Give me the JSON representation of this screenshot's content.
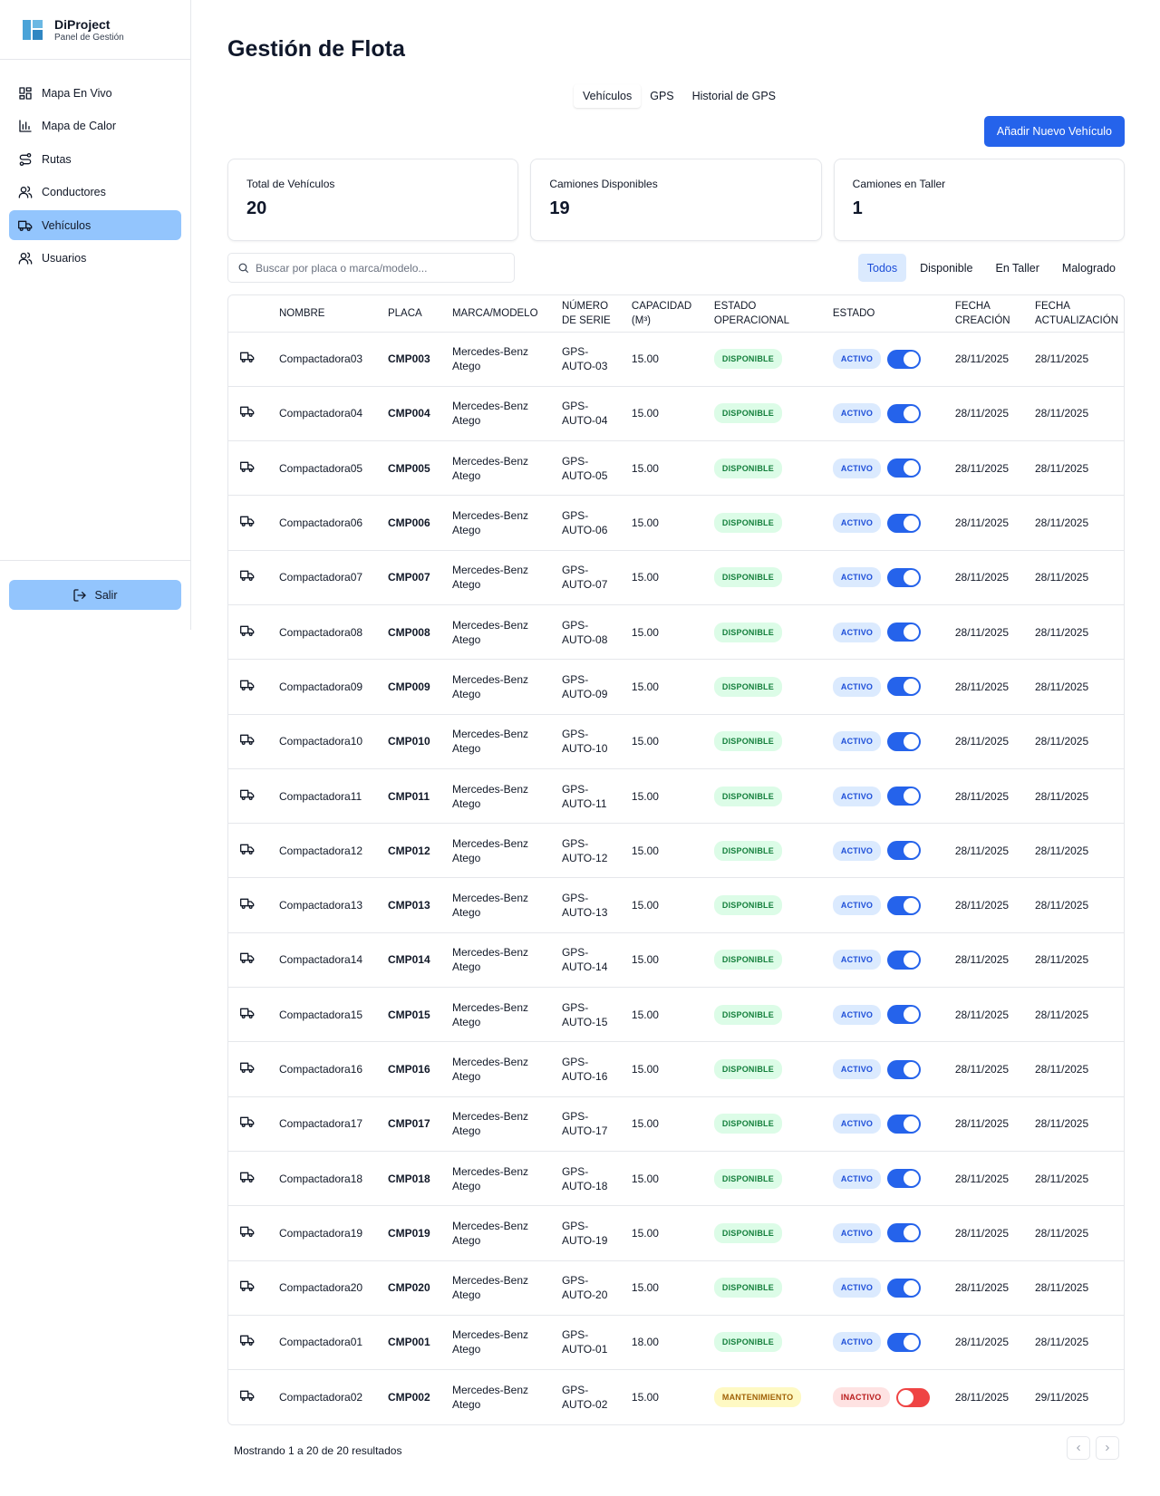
{
  "brand": {
    "title": "DiProject",
    "subtitle": "Panel de Gestión"
  },
  "sidebar": {
    "items": [
      {
        "label": "Mapa En Vivo",
        "icon": "grid-icon"
      },
      {
        "label": "Mapa de Calor",
        "icon": "bar-chart-icon"
      },
      {
        "label": "Rutas",
        "icon": "route-icon"
      },
      {
        "label": "Conductores",
        "icon": "users-icon"
      },
      {
        "label": "Vehículos",
        "icon": "truck-icon",
        "active": true
      },
      {
        "label": "Usuarios",
        "icon": "users-icon"
      }
    ],
    "logout_label": "Salir"
  },
  "page": {
    "title": "Gestión de Flota"
  },
  "tabs": [
    "Vehículos",
    "GPS",
    "Historial de GPS"
  ],
  "add_button_label": "Añadir Nuevo Vehículo",
  "stats": [
    {
      "label": "Total de Vehículos",
      "value": "20"
    },
    {
      "label": "Camiones Disponibles",
      "value": "19"
    },
    {
      "label": "Camiones en Taller",
      "value": "1"
    }
  ],
  "search": {
    "placeholder": "Buscar por placa o marca/modelo..."
  },
  "filters": [
    "Todos",
    "Disponible",
    "En Taller",
    "Malogrado"
  ],
  "table": {
    "headers": {
      "name": "NOMBRE",
      "plate": "PLACA",
      "brand": "MARCA/MODELO",
      "serial": "NÚMERO DE SERIE",
      "capacity": "CAPACIDAD (M³)",
      "op_status": "ESTADO OPERACIONAL",
      "status": "ESTADO",
      "created": "FECHA CREACIÓN",
      "updated": "FECHA ACTUALIZACIÓN"
    },
    "rows": [
      {
        "name": "Compactadora03",
        "plate": "CMP003",
        "brand": "Mercedes-Benz Atego",
        "serial": "GPS-AUTO-03",
        "capacity": "15.00",
        "op_status": "DISPONIBLE",
        "status": "ACTIVO",
        "active": true,
        "created": "28/11/2025",
        "updated": "28/11/2025"
      },
      {
        "name": "Compactadora04",
        "plate": "CMP004",
        "brand": "Mercedes-Benz Atego",
        "serial": "GPS-AUTO-04",
        "capacity": "15.00",
        "op_status": "DISPONIBLE",
        "status": "ACTIVO",
        "active": true,
        "created": "28/11/2025",
        "updated": "28/11/2025"
      },
      {
        "name": "Compactadora05",
        "plate": "CMP005",
        "brand": "Mercedes-Benz Atego",
        "serial": "GPS-AUTO-05",
        "capacity": "15.00",
        "op_status": "DISPONIBLE",
        "status": "ACTIVO",
        "active": true,
        "created": "28/11/2025",
        "updated": "28/11/2025"
      },
      {
        "name": "Compactadora06",
        "plate": "CMP006",
        "brand": "Mercedes-Benz Atego",
        "serial": "GPS-AUTO-06",
        "capacity": "15.00",
        "op_status": "DISPONIBLE",
        "status": "ACTIVO",
        "active": true,
        "created": "28/11/2025",
        "updated": "28/11/2025"
      },
      {
        "name": "Compactadora07",
        "plate": "CMP007",
        "brand": "Mercedes-Benz Atego",
        "serial": "GPS-AUTO-07",
        "capacity": "15.00",
        "op_status": "DISPONIBLE",
        "status": "ACTIVO",
        "active": true,
        "created": "28/11/2025",
        "updated": "28/11/2025"
      },
      {
        "name": "Compactadora08",
        "plate": "CMP008",
        "brand": "Mercedes-Benz Atego",
        "serial": "GPS-AUTO-08",
        "capacity": "15.00",
        "op_status": "DISPONIBLE",
        "status": "ACTIVO",
        "active": true,
        "created": "28/11/2025",
        "updated": "28/11/2025"
      },
      {
        "name": "Compactadora09",
        "plate": "CMP009",
        "brand": "Mercedes-Benz Atego",
        "serial": "GPS-AUTO-09",
        "capacity": "15.00",
        "op_status": "DISPONIBLE",
        "status": "ACTIVO",
        "active": true,
        "created": "28/11/2025",
        "updated": "28/11/2025"
      },
      {
        "name": "Compactadora10",
        "plate": "CMP010",
        "brand": "Mercedes-Benz Atego",
        "serial": "GPS-AUTO-10",
        "capacity": "15.00",
        "op_status": "DISPONIBLE",
        "status": "ACTIVO",
        "active": true,
        "created": "28/11/2025",
        "updated": "28/11/2025"
      },
      {
        "name": "Compactadora11",
        "plate": "CMP011",
        "brand": "Mercedes-Benz Atego",
        "serial": "GPS-AUTO-11",
        "capacity": "15.00",
        "op_status": "DISPONIBLE",
        "status": "ACTIVO",
        "active": true,
        "created": "28/11/2025",
        "updated": "28/11/2025"
      },
      {
        "name": "Compactadora12",
        "plate": "CMP012",
        "brand": "Mercedes-Benz Atego",
        "serial": "GPS-AUTO-12",
        "capacity": "15.00",
        "op_status": "DISPONIBLE",
        "status": "ACTIVO",
        "active": true,
        "created": "28/11/2025",
        "updated": "28/11/2025"
      },
      {
        "name": "Compactadora13",
        "plate": "CMP013",
        "brand": "Mercedes-Benz Atego",
        "serial": "GPS-AUTO-13",
        "capacity": "15.00",
        "op_status": "DISPONIBLE",
        "status": "ACTIVO",
        "active": true,
        "created": "28/11/2025",
        "updated": "28/11/2025"
      },
      {
        "name": "Compactadora14",
        "plate": "CMP014",
        "brand": "Mercedes-Benz Atego",
        "serial": "GPS-AUTO-14",
        "capacity": "15.00",
        "op_status": "DISPONIBLE",
        "status": "ACTIVO",
        "active": true,
        "created": "28/11/2025",
        "updated": "28/11/2025"
      },
      {
        "name": "Compactadora15",
        "plate": "CMP015",
        "brand": "Mercedes-Benz Atego",
        "serial": "GPS-AUTO-15",
        "capacity": "15.00",
        "op_status": "DISPONIBLE",
        "status": "ACTIVO",
        "active": true,
        "created": "28/11/2025",
        "updated": "28/11/2025"
      },
      {
        "name": "Compactadora16",
        "plate": "CMP016",
        "brand": "Mercedes-Benz Atego",
        "serial": "GPS-AUTO-16",
        "capacity": "15.00",
        "op_status": "DISPONIBLE",
        "status": "ACTIVO",
        "active": true,
        "created": "28/11/2025",
        "updated": "28/11/2025"
      },
      {
        "name": "Compactadora17",
        "plate": "CMP017",
        "brand": "Mercedes-Benz Atego",
        "serial": "GPS-AUTO-17",
        "capacity": "15.00",
        "op_status": "DISPONIBLE",
        "status": "ACTIVO",
        "active": true,
        "created": "28/11/2025",
        "updated": "28/11/2025"
      },
      {
        "name": "Compactadora18",
        "plate": "CMP018",
        "brand": "Mercedes-Benz Atego",
        "serial": "GPS-AUTO-18",
        "capacity": "15.00",
        "op_status": "DISPONIBLE",
        "status": "ACTIVO",
        "active": true,
        "created": "28/11/2025",
        "updated": "28/11/2025"
      },
      {
        "name": "Compactadora19",
        "plate": "CMP019",
        "brand": "Mercedes-Benz Atego",
        "serial": "GPS-AUTO-19",
        "capacity": "15.00",
        "op_status": "DISPONIBLE",
        "status": "ACTIVO",
        "active": true,
        "created": "28/11/2025",
        "updated": "28/11/2025"
      },
      {
        "name": "Compactadora20",
        "plate": "CMP020",
        "brand": "Mercedes-Benz Atego",
        "serial": "GPS-AUTO-20",
        "capacity": "15.00",
        "op_status": "DISPONIBLE",
        "status": "ACTIVO",
        "active": true,
        "created": "28/11/2025",
        "updated": "28/11/2025"
      },
      {
        "name": "Compactadora01",
        "plate": "CMP001",
        "brand": "Mercedes-Benz Atego",
        "serial": "GPS-AUTO-01",
        "capacity": "18.00",
        "op_status": "DISPONIBLE",
        "status": "ACTIVO",
        "active": true,
        "created": "28/11/2025",
        "updated": "28/11/2025"
      },
      {
        "name": "Compactadora02",
        "plate": "CMP002",
        "brand": "Mercedes-Benz Atego",
        "serial": "GPS-AUTO-02",
        "capacity": "15.00",
        "op_status": "MANTENIMIENTO",
        "status": "INACTIVO",
        "active": false,
        "created": "28/11/2025",
        "updated": "29/11/2025"
      }
    ]
  },
  "footer": {
    "results_text": "Mostrando 1 a 20 de 20 resultados"
  },
  "colors": {
    "accent": "#2563eb",
    "active_nav": "#93c5fd",
    "available": "#15803d",
    "maintenance": "#a16207",
    "inactive": "#ef4444"
  }
}
